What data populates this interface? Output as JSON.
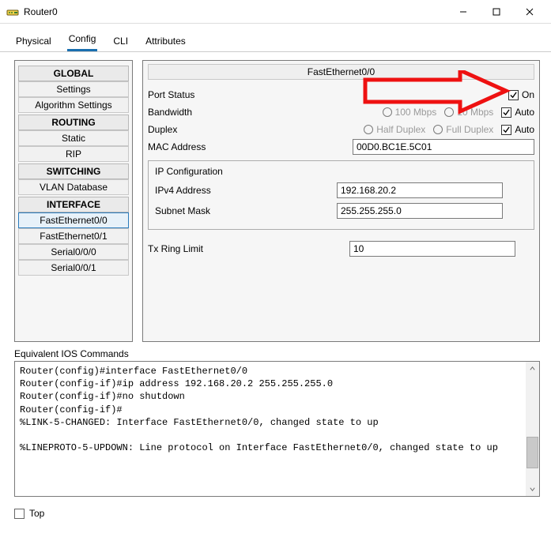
{
  "window": {
    "title": "Router0"
  },
  "tabs": {
    "physical": "Physical",
    "config": "Config",
    "cli": "CLI",
    "attributes": "Attributes"
  },
  "sidebar": {
    "global": "GLOBAL",
    "settings": "Settings",
    "algorithm_settings": "Algorithm Settings",
    "routing": "ROUTING",
    "static": "Static",
    "rip": "RIP",
    "switching": "SWITCHING",
    "vlan": "VLAN Database",
    "interface": "INTERFACE",
    "fe00": "FastEthernet0/0",
    "fe01": "FastEthernet0/1",
    "s000": "Serial0/0/0",
    "s001": "Serial0/0/1"
  },
  "panel": {
    "title": "FastEthernet0/0",
    "port_status": "Port Status",
    "on": "On",
    "bandwidth": "Bandwidth",
    "bw_100": "100 Mbps",
    "bw_10": "10 Mbps",
    "auto": "Auto",
    "duplex": "Duplex",
    "half": "Half Duplex",
    "full": "Full Duplex",
    "mac": "MAC Address",
    "mac_val": "00D0.BC1E.5C01",
    "ipcfg": "IP Configuration",
    "ipv4": "IPv4 Address",
    "ipv4_val": "192.168.20.2",
    "mask": "Subnet Mask",
    "mask_val": "255.255.255.0",
    "txring": "Tx Ring Limit",
    "txring_val": "10"
  },
  "ios": {
    "header": "Equivalent IOS Commands",
    "text": "Router(config)#interface FastEthernet0/0\nRouter(config-if)#ip address 192.168.20.2 255.255.255.0\nRouter(config-if)#no shutdown\nRouter(config-if)#\n%LINK-5-CHANGED: Interface FastEthernet0/0, changed state to up\n\n%LINEPROTO-5-UPDOWN: Line protocol on Interface FastEthernet0/0, changed state to up\n"
  },
  "bottom": {
    "top": "Top"
  }
}
